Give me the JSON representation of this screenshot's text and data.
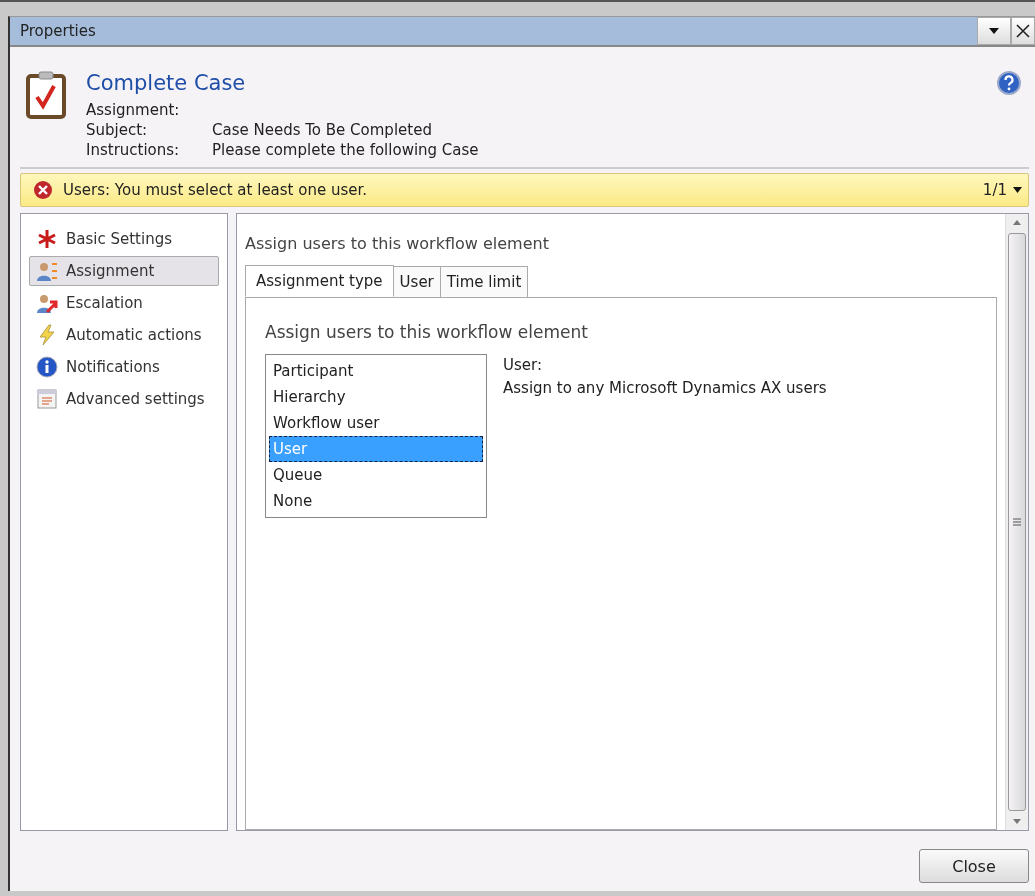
{
  "window": {
    "title": "Properties"
  },
  "header": {
    "title": "Complete Case",
    "fields": [
      {
        "label": "Assignment:"
      },
      {
        "label": "Subject:",
        "value": "Case Needs To Be Completed"
      },
      {
        "label": "Instructions:",
        "value": "Please complete the following Case"
      }
    ]
  },
  "warning": {
    "message": "Users: You must select at least one user.",
    "counter": "1/1"
  },
  "sidebar": {
    "items": [
      {
        "kind": "required",
        "label": "Basic Settings",
        "selected": false
      },
      {
        "kind": "assignment",
        "label": "Assignment",
        "selected": true
      },
      {
        "kind": "escalation",
        "label": "Escalation",
        "selected": false
      },
      {
        "kind": "automatic",
        "label": "Automatic actions",
        "selected": false
      },
      {
        "kind": "info",
        "label": "Notifications",
        "selected": false
      },
      {
        "kind": "advanced",
        "label": "Advanced settings",
        "selected": false
      }
    ]
  },
  "content": {
    "heading": "Assign users to this workflow element",
    "tabs": [
      {
        "label": "Assignment type",
        "selected": true
      },
      {
        "label": "User",
        "selected": false
      },
      {
        "label": "Time limit",
        "selected": false
      }
    ],
    "section_heading": "Assign users to this workflow element",
    "assignment_types": [
      {
        "label": "Participant",
        "selected": false
      },
      {
        "label": "Hierarchy",
        "selected": false
      },
      {
        "label": "Workflow user",
        "selected": false
      },
      {
        "label": "User",
        "selected": true
      },
      {
        "label": "Queue",
        "selected": false
      },
      {
        "label": "None",
        "selected": false
      }
    ],
    "description_title": "User:",
    "description": "Assign to any Microsoft Dynamics AX users"
  },
  "buttons": {
    "close": "Close"
  }
}
